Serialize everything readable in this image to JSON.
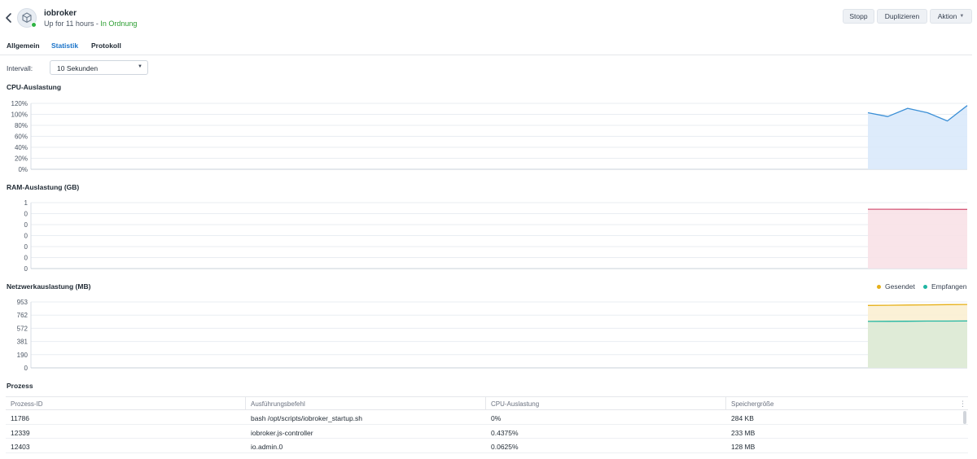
{
  "header": {
    "title": "iobroker",
    "status_prefix": "Up for 11 hours - ",
    "status_ok": "In Ordnung",
    "buttons": {
      "stop": "Stopp",
      "duplicate": "Duplizieren",
      "action": "Aktion"
    }
  },
  "tabs": [
    {
      "label": "Allgemein",
      "active": false
    },
    {
      "label": "Statistik",
      "active": true
    },
    {
      "label": "Protokoll",
      "active": false
    }
  ],
  "interval": {
    "label": "Intervall:",
    "value": "10 Sekunden"
  },
  "colors": {
    "accent": "#1a73c9",
    "ok": "#2a9d2f",
    "cpu_line": "#3b8fd6",
    "cpu_fill": "#d9e9fb",
    "ram_line": "#d55a7a",
    "ram_fill": "#f8e1e7",
    "sent_line": "#e6b019",
    "sent_fill": "#fbefd2",
    "recv_line": "#1fb5a2",
    "recv_fill": "#dcead7"
  },
  "chart_data": [
    {
      "type": "area",
      "title": "CPU-Auslastung",
      "y_ticks": [
        "120%",
        "100%",
        "80%",
        "60%",
        "40%",
        "20%",
        "0%"
      ],
      "ylim": [
        0,
        120
      ],
      "series": [
        {
          "values": [
            103,
            96,
            111,
            103,
            88,
            116
          ]
        }
      ]
    },
    {
      "type": "area",
      "title": "RAM-Auslastung (GB)",
      "y_ticks": [
        "1",
        "0",
        "0",
        "0",
        "0",
        "0",
        "0"
      ],
      "ylim": [
        0,
        1.2
      ],
      "series": [
        {
          "values": [
            1.08,
            1.08,
            1.078,
            1.078,
            1.077,
            1.077
          ]
        }
      ]
    },
    {
      "type": "area",
      "title": "Netzwerkauslastung (MB)",
      "y_ticks": [
        "953",
        "762",
        "572",
        "381",
        "190",
        "0"
      ],
      "ylim": [
        0,
        953
      ],
      "legend": "top-right",
      "series": [
        {
          "name": "Gesendet",
          "values": [
            902,
            905,
            908,
            911,
            914,
            917
          ]
        },
        {
          "name": "Empfangen",
          "values": [
            672,
            673,
            674,
            676,
            677,
            678
          ]
        }
      ]
    }
  ],
  "process": {
    "title": "Prozess",
    "columns": [
      "Prozess-ID",
      "Ausführungsbefehl",
      "CPU-Auslastung",
      "Speichergröße"
    ],
    "rows": [
      [
        "11786",
        "bash /opt/scripts/iobroker_startup.sh",
        "0%",
        "284 KB"
      ],
      [
        "12339",
        "iobroker.js-controller",
        "0.4375%",
        "233 MB"
      ],
      [
        "12403",
        "io.admin.0",
        "0.0625%",
        "128 MB"
      ]
    ]
  }
}
